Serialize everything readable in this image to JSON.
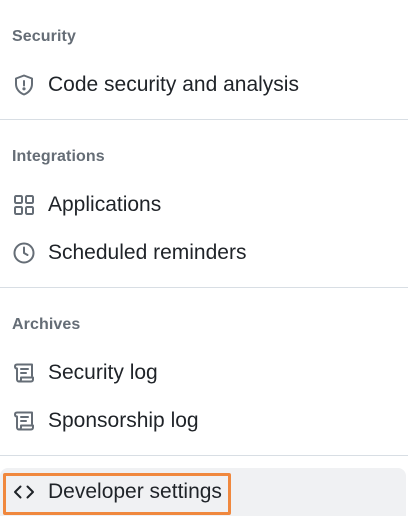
{
  "sections": {
    "security": {
      "heading": "Security",
      "items": [
        {
          "label": "Code security and analysis",
          "icon": "shield-icon"
        }
      ]
    },
    "integrations": {
      "heading": "Integrations",
      "items": [
        {
          "label": "Applications",
          "icon": "apps-grid-icon"
        },
        {
          "label": "Scheduled reminders",
          "icon": "clock-icon"
        }
      ]
    },
    "archives": {
      "heading": "Archives",
      "items": [
        {
          "label": "Security log",
          "icon": "log-icon"
        },
        {
          "label": "Sponsorship log",
          "icon": "log-icon"
        }
      ]
    },
    "developer": {
      "items": [
        {
          "label": "Developer settings",
          "icon": "code-icon"
        }
      ]
    }
  },
  "colors": {
    "heading": "#656d76",
    "text": "#1f2328",
    "icon": "#656d76",
    "divider": "#d8dee4",
    "active_bg": "#f0f1f3",
    "highlight": "#f0883e"
  }
}
